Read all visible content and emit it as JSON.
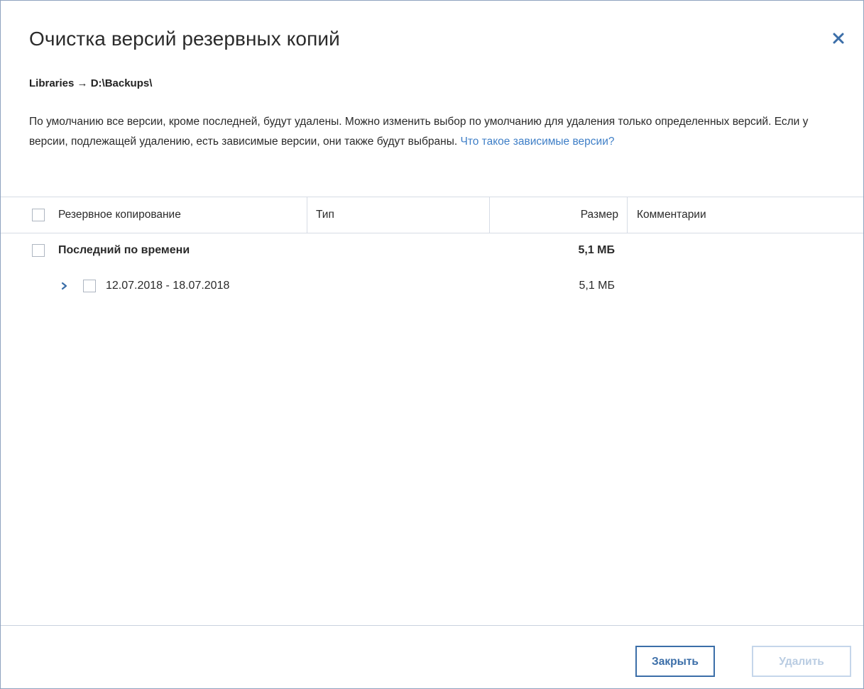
{
  "dialog": {
    "title": "Очистка версий резервных копий",
    "path": "Libraries → D:\\Backups\\",
    "description": "По умолчанию все версии, кроме последней, будут удалены. Можно изменить выбор по умолчанию для удаления только определенных версий. Если у версии, подлежащей удалению, есть зависимые версии, они также будут выбраны.",
    "link_text": "Что такое зависимые версии?"
  },
  "table": {
    "columns": [
      "Резервное копирование",
      "Тип",
      "Размер",
      "Комментарии"
    ],
    "rows": [
      {
        "label": "Последний по времени",
        "type": "",
        "size": "5,1 МБ",
        "comment": "",
        "checked": false
      },
      {
        "label": "12.07.2018 - 18.07.2018",
        "type": "",
        "size": "5,1 МБ",
        "comment": "",
        "checked": false,
        "expandable": true
      }
    ]
  },
  "footer": {
    "close_label": "Закрыть",
    "delete_label": "Удалить",
    "delete_enabled": false
  },
  "colors": {
    "accent": "#3b6ea8",
    "link": "#3f7fc7",
    "disabled": "#b9cce2",
    "border": "#d6dce5"
  },
  "icons": {
    "close": "close-icon",
    "expand": "chevron-right-icon"
  }
}
